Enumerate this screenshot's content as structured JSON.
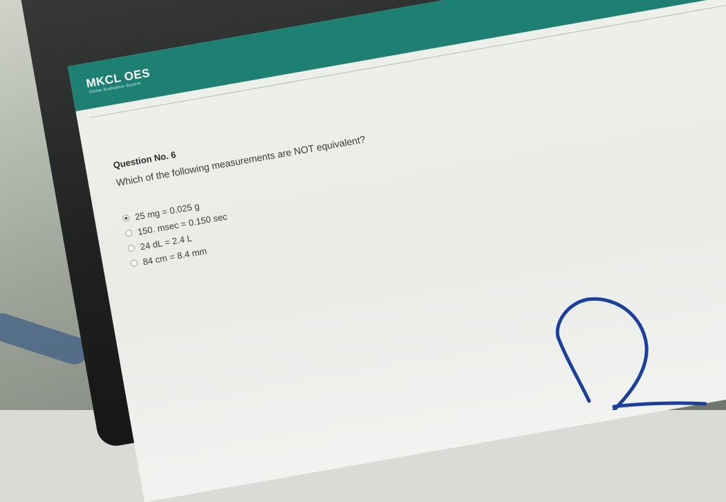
{
  "app": {
    "name": "MKCL OES",
    "subtitle": "Online Evaluation System"
  },
  "question": {
    "number_label": "Question No. 6",
    "text": "Which of the following measurements are NOT equivalent?",
    "options": [
      {
        "label": "25 mg = 0.025 g",
        "selected": true
      },
      {
        "label": "150. msec = 0.150 sec",
        "selected": false
      },
      {
        "label": "24 dL = 2.4 L",
        "selected": false
      },
      {
        "label": "84 cm = 8.4 mm",
        "selected": false
      }
    ]
  },
  "colors": {
    "header": "#1e7f73",
    "ink": "#1b3f9a"
  }
}
